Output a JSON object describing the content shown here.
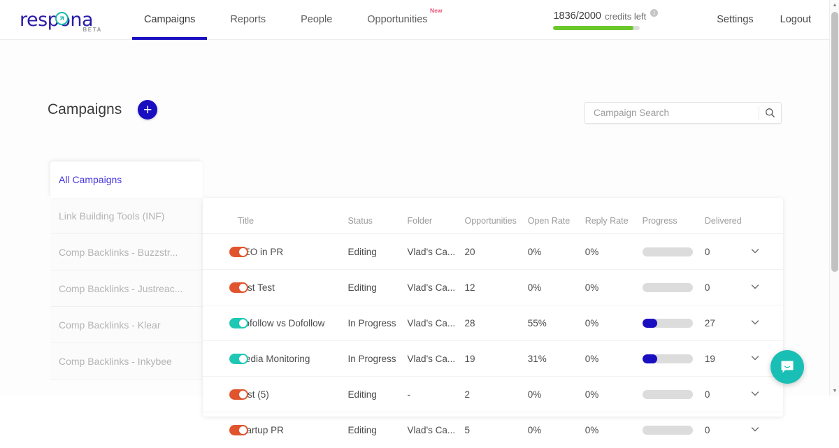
{
  "brand": {
    "name": "respona",
    "beta": "BETA",
    "accent_blue": "#1a0fc0",
    "accent_teal": "#17b8a6",
    "accent_orange": "#e0542e"
  },
  "nav": {
    "items": [
      {
        "label": "Campaigns",
        "badge": ""
      },
      {
        "label": "Reports",
        "badge": ""
      },
      {
        "label": "People",
        "badge": ""
      },
      {
        "label": "Opportunities",
        "badge": "New"
      }
    ]
  },
  "topright": {
    "credits_value": "1836/2000",
    "credits_label": "credits left",
    "info_glyph": "i",
    "credits_percent": 92,
    "settings_label": "Settings",
    "logout_label": "Logout"
  },
  "page": {
    "title": "Campaigns",
    "add_label": "+"
  },
  "search": {
    "placeholder": "Campaign Search",
    "value": ""
  },
  "sidebar": {
    "items": [
      {
        "label": "All Campaigns",
        "active": true
      },
      {
        "label": "Link Building Tools (INF)",
        "active": false
      },
      {
        "label": "Comp Backlinks - Buzzstr...",
        "active": false
      },
      {
        "label": "Comp Backlinks - Justreac...",
        "active": false
      },
      {
        "label": "Comp Backlinks - Klear",
        "active": false
      },
      {
        "label": "Comp Backlinks - Inkybee",
        "active": false
      }
    ]
  },
  "table": {
    "headers": {
      "toggle": "",
      "title": "Title",
      "status": "Status",
      "folder": "Folder",
      "opportunities": "Opportunities",
      "open_rate": "Open Rate",
      "reply_rate": "Reply Rate",
      "progress": "Progress",
      "delivered": "Delivered"
    },
    "rows": [
      {
        "enabled": false,
        "title": "SEO in PR",
        "status": "Editing",
        "folder": "Vlad's Ca...",
        "opportunities": "20",
        "open_rate": "0%",
        "reply_rate": "0%",
        "progress": 0,
        "delivered": "0"
      },
      {
        "enabled": false,
        "title": "Test Test",
        "status": "Editing",
        "folder": "Vlad's Ca...",
        "opportunities": "12",
        "open_rate": "0%",
        "reply_rate": "0%",
        "progress": 0,
        "delivered": "0"
      },
      {
        "enabled": true,
        "title": "Nofollow vs Dofollow",
        "status": "In Progress",
        "folder": "Vlad's Ca...",
        "opportunities": "28",
        "open_rate": "55%",
        "reply_rate": "0%",
        "progress": 30,
        "delivered": "27"
      },
      {
        "enabled": true,
        "title": "Media Monitoring",
        "status": "In Progress",
        "folder": "Vlad's Ca...",
        "opportunities": "19",
        "open_rate": "31%",
        "reply_rate": "0%",
        "progress": 30,
        "delivered": "19"
      },
      {
        "enabled": false,
        "title": "Test (5)",
        "status": "Editing",
        "folder": "-",
        "opportunities": "2",
        "open_rate": "0%",
        "reply_rate": "0%",
        "progress": 0,
        "delivered": "0"
      },
      {
        "enabled": false,
        "title": "Startup PR",
        "status": "Editing",
        "folder": "Vlad's Ca...",
        "opportunities": "5",
        "open_rate": "0%",
        "reply_rate": "0%",
        "progress": 0,
        "delivered": "0"
      }
    ]
  },
  "chat": {
    "icon": "chat-bubble-icon"
  },
  "scrollbar": {
    "up": "▲",
    "down": "▼"
  }
}
